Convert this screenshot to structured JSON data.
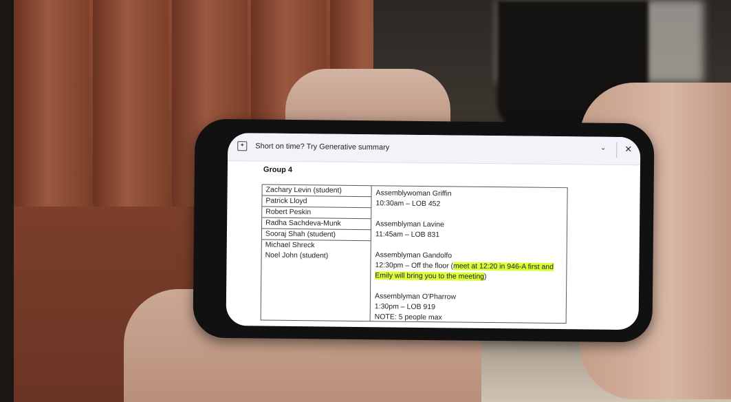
{
  "banner": {
    "title": "Short on time? Try Generative summary",
    "collapse_icon": "chevron-down-icon",
    "close_icon": "close-icon"
  },
  "group": {
    "heading": "Group 4",
    "members": [
      "Zachary Levin (student)",
      "Patrick Lloyd",
      "Robert Peskin",
      "Radha Sachdeva-Munk",
      "Sooraj Shah (student)",
      "Michael Shreck",
      "Noel John (student)"
    ]
  },
  "meetings": [
    {
      "member": "Assemblywoman Griffin",
      "when": "10:30am – LOB 452"
    },
    {
      "member": "Assemblyman Lavine",
      "when": "11:45am – LOB 831"
    },
    {
      "member": "Assemblyman Gandolfo",
      "when_prefix": "12:30pm – Off the floor (",
      "highlight": "meet at 12:20 in 946-A first and Emily will bring you to the meeting",
      "when_suffix": ")"
    },
    {
      "member": "Assemblyman O'Pharrow",
      "when": "1:30pm – LOB 919",
      "note": "NOTE: 5 people max"
    }
  ],
  "colors": {
    "highlight": "#d8ff3a",
    "couch": "#7a3f2b"
  }
}
